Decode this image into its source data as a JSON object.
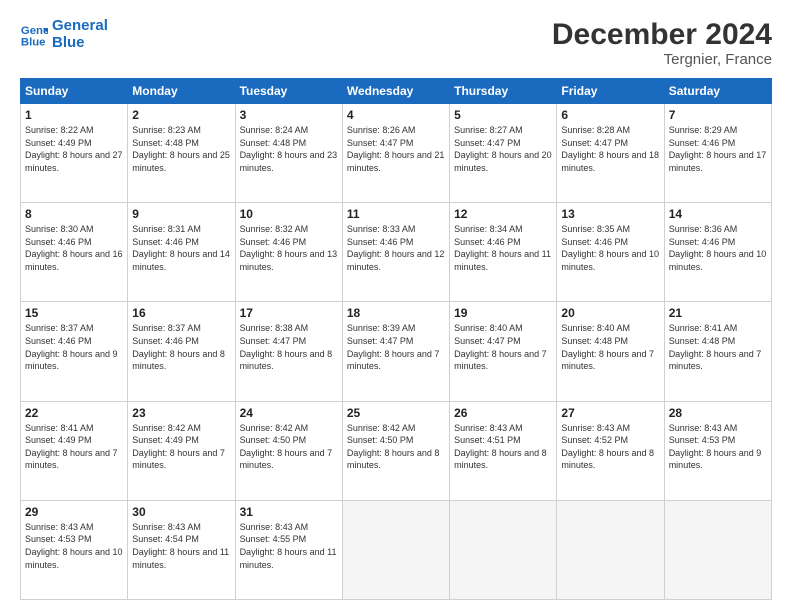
{
  "header": {
    "logo_line1": "General",
    "logo_line2": "Blue",
    "title": "December 2024",
    "subtitle": "Tergnier, France"
  },
  "weekdays": [
    "Sunday",
    "Monday",
    "Tuesday",
    "Wednesday",
    "Thursday",
    "Friday",
    "Saturday"
  ],
  "weeks": [
    [
      {
        "day": "1",
        "rise": "8:22 AM",
        "set": "4:49 PM",
        "daylight": "8 hours and 27 minutes."
      },
      {
        "day": "2",
        "rise": "8:23 AM",
        "set": "4:48 PM",
        "daylight": "8 hours and 25 minutes."
      },
      {
        "day": "3",
        "rise": "8:24 AM",
        "set": "4:48 PM",
        "daylight": "8 hours and 23 minutes."
      },
      {
        "day": "4",
        "rise": "8:26 AM",
        "set": "4:47 PM",
        "daylight": "8 hours and 21 minutes."
      },
      {
        "day": "5",
        "rise": "8:27 AM",
        "set": "4:47 PM",
        "daylight": "8 hours and 20 minutes."
      },
      {
        "day": "6",
        "rise": "8:28 AM",
        "set": "4:47 PM",
        "daylight": "8 hours and 18 minutes."
      },
      {
        "day": "7",
        "rise": "8:29 AM",
        "set": "4:46 PM",
        "daylight": "8 hours and 17 minutes."
      }
    ],
    [
      {
        "day": "8",
        "rise": "8:30 AM",
        "set": "4:46 PM",
        "daylight": "8 hours and 16 minutes."
      },
      {
        "day": "9",
        "rise": "8:31 AM",
        "set": "4:46 PM",
        "daylight": "8 hours and 14 minutes."
      },
      {
        "day": "10",
        "rise": "8:32 AM",
        "set": "4:46 PM",
        "daylight": "8 hours and 13 minutes."
      },
      {
        "day": "11",
        "rise": "8:33 AM",
        "set": "4:46 PM",
        "daylight": "8 hours and 12 minutes."
      },
      {
        "day": "12",
        "rise": "8:34 AM",
        "set": "4:46 PM",
        "daylight": "8 hours and 11 minutes."
      },
      {
        "day": "13",
        "rise": "8:35 AM",
        "set": "4:46 PM",
        "daylight": "8 hours and 10 minutes."
      },
      {
        "day": "14",
        "rise": "8:36 AM",
        "set": "4:46 PM",
        "daylight": "8 hours and 10 minutes."
      }
    ],
    [
      {
        "day": "15",
        "rise": "8:37 AM",
        "set": "4:46 PM",
        "daylight": "8 hours and 9 minutes."
      },
      {
        "day": "16",
        "rise": "8:37 AM",
        "set": "4:46 PM",
        "daylight": "8 hours and 8 minutes."
      },
      {
        "day": "17",
        "rise": "8:38 AM",
        "set": "4:47 PM",
        "daylight": "8 hours and 8 minutes."
      },
      {
        "day": "18",
        "rise": "8:39 AM",
        "set": "4:47 PM",
        "daylight": "8 hours and 7 minutes."
      },
      {
        "day": "19",
        "rise": "8:40 AM",
        "set": "4:47 PM",
        "daylight": "8 hours and 7 minutes."
      },
      {
        "day": "20",
        "rise": "8:40 AM",
        "set": "4:48 PM",
        "daylight": "8 hours and 7 minutes."
      },
      {
        "day": "21",
        "rise": "8:41 AM",
        "set": "4:48 PM",
        "daylight": "8 hours and 7 minutes."
      }
    ],
    [
      {
        "day": "22",
        "rise": "8:41 AM",
        "set": "4:49 PM",
        "daylight": "8 hours and 7 minutes."
      },
      {
        "day": "23",
        "rise": "8:42 AM",
        "set": "4:49 PM",
        "daylight": "8 hours and 7 minutes."
      },
      {
        "day": "24",
        "rise": "8:42 AM",
        "set": "4:50 PM",
        "daylight": "8 hours and 7 minutes."
      },
      {
        "day": "25",
        "rise": "8:42 AM",
        "set": "4:50 PM",
        "daylight": "8 hours and 8 minutes."
      },
      {
        "day": "26",
        "rise": "8:43 AM",
        "set": "4:51 PM",
        "daylight": "8 hours and 8 minutes."
      },
      {
        "day": "27",
        "rise": "8:43 AM",
        "set": "4:52 PM",
        "daylight": "8 hours and 8 minutes."
      },
      {
        "day": "28",
        "rise": "8:43 AM",
        "set": "4:53 PM",
        "daylight": "8 hours and 9 minutes."
      }
    ],
    [
      {
        "day": "29",
        "rise": "8:43 AM",
        "set": "4:53 PM",
        "daylight": "8 hours and 10 minutes."
      },
      {
        "day": "30",
        "rise": "8:43 AM",
        "set": "4:54 PM",
        "daylight": "8 hours and 11 minutes."
      },
      {
        "day": "31",
        "rise": "8:43 AM",
        "set": "4:55 PM",
        "daylight": "8 hours and 11 minutes."
      },
      null,
      null,
      null,
      null
    ]
  ],
  "labels": {
    "sunrise": "Sunrise:",
    "sunset": "Sunset:",
    "daylight": "Daylight:"
  }
}
